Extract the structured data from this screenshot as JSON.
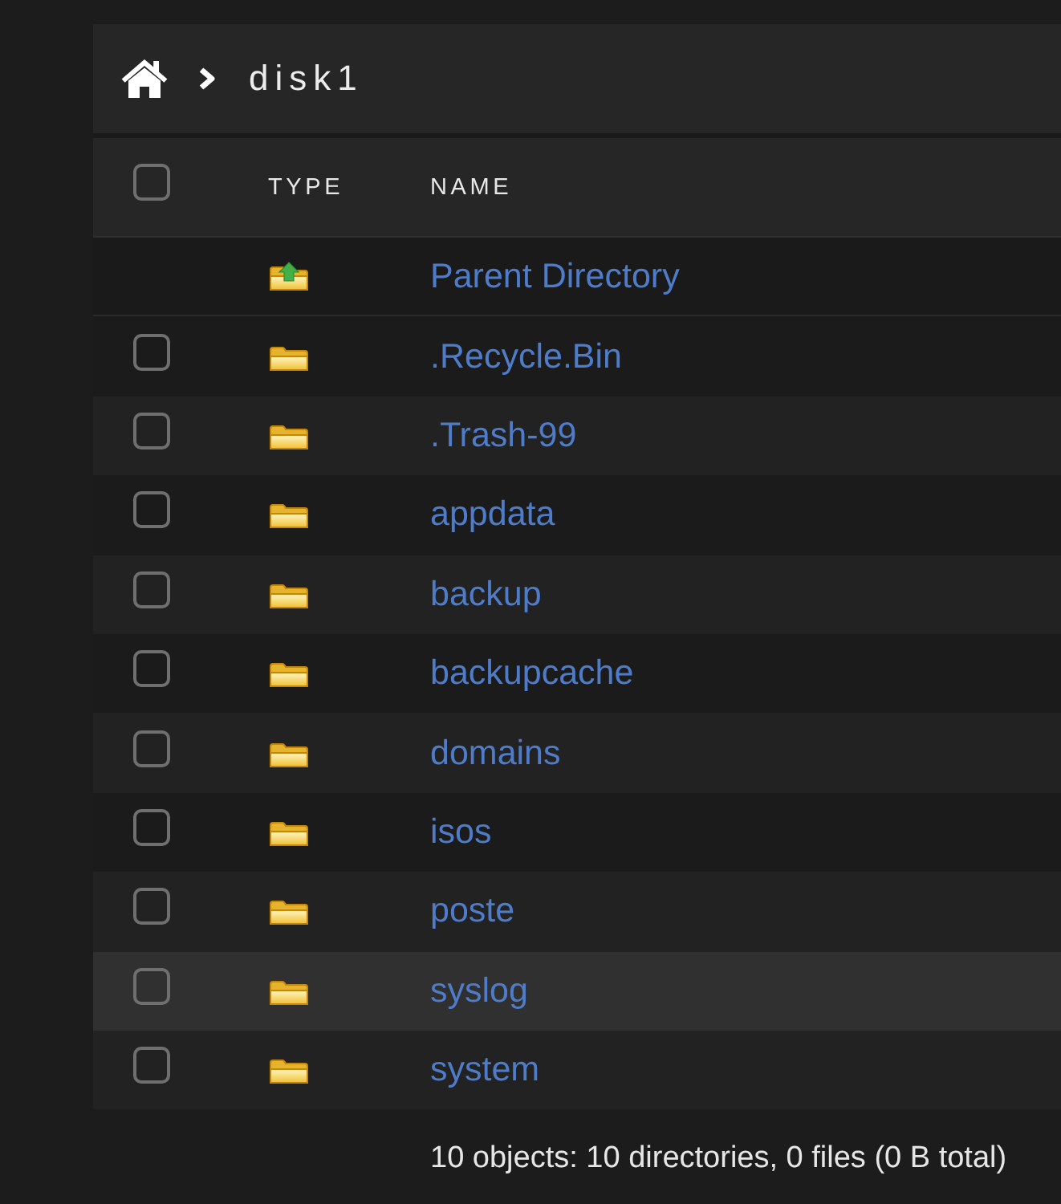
{
  "breadcrumb": {
    "current": "disk1"
  },
  "table": {
    "select_all": {
      "checked": false
    },
    "columns": [
      "TYPE",
      "NAME"
    ],
    "parent_row": {
      "name": "Parent Directory"
    },
    "rows": [
      {
        "name": ".Recycle.Bin",
        "checked": false,
        "highlighted": false
      },
      {
        "name": ".Trash-99",
        "checked": false,
        "highlighted": false
      },
      {
        "name": "appdata",
        "checked": false,
        "highlighted": false
      },
      {
        "name": "backup",
        "checked": false,
        "highlighted": false
      },
      {
        "name": "backupcache",
        "checked": false,
        "highlighted": false
      },
      {
        "name": "domains",
        "checked": false,
        "highlighted": false
      },
      {
        "name": "isos",
        "checked": false,
        "highlighted": false
      },
      {
        "name": "poste",
        "checked": false,
        "highlighted": false
      },
      {
        "name": "syslog",
        "checked": false,
        "highlighted": true
      },
      {
        "name": "system",
        "checked": false,
        "highlighted": false
      }
    ]
  },
  "status_bar": {
    "text": "10 objects: 10 directories, 0 files (0 B total)"
  }
}
